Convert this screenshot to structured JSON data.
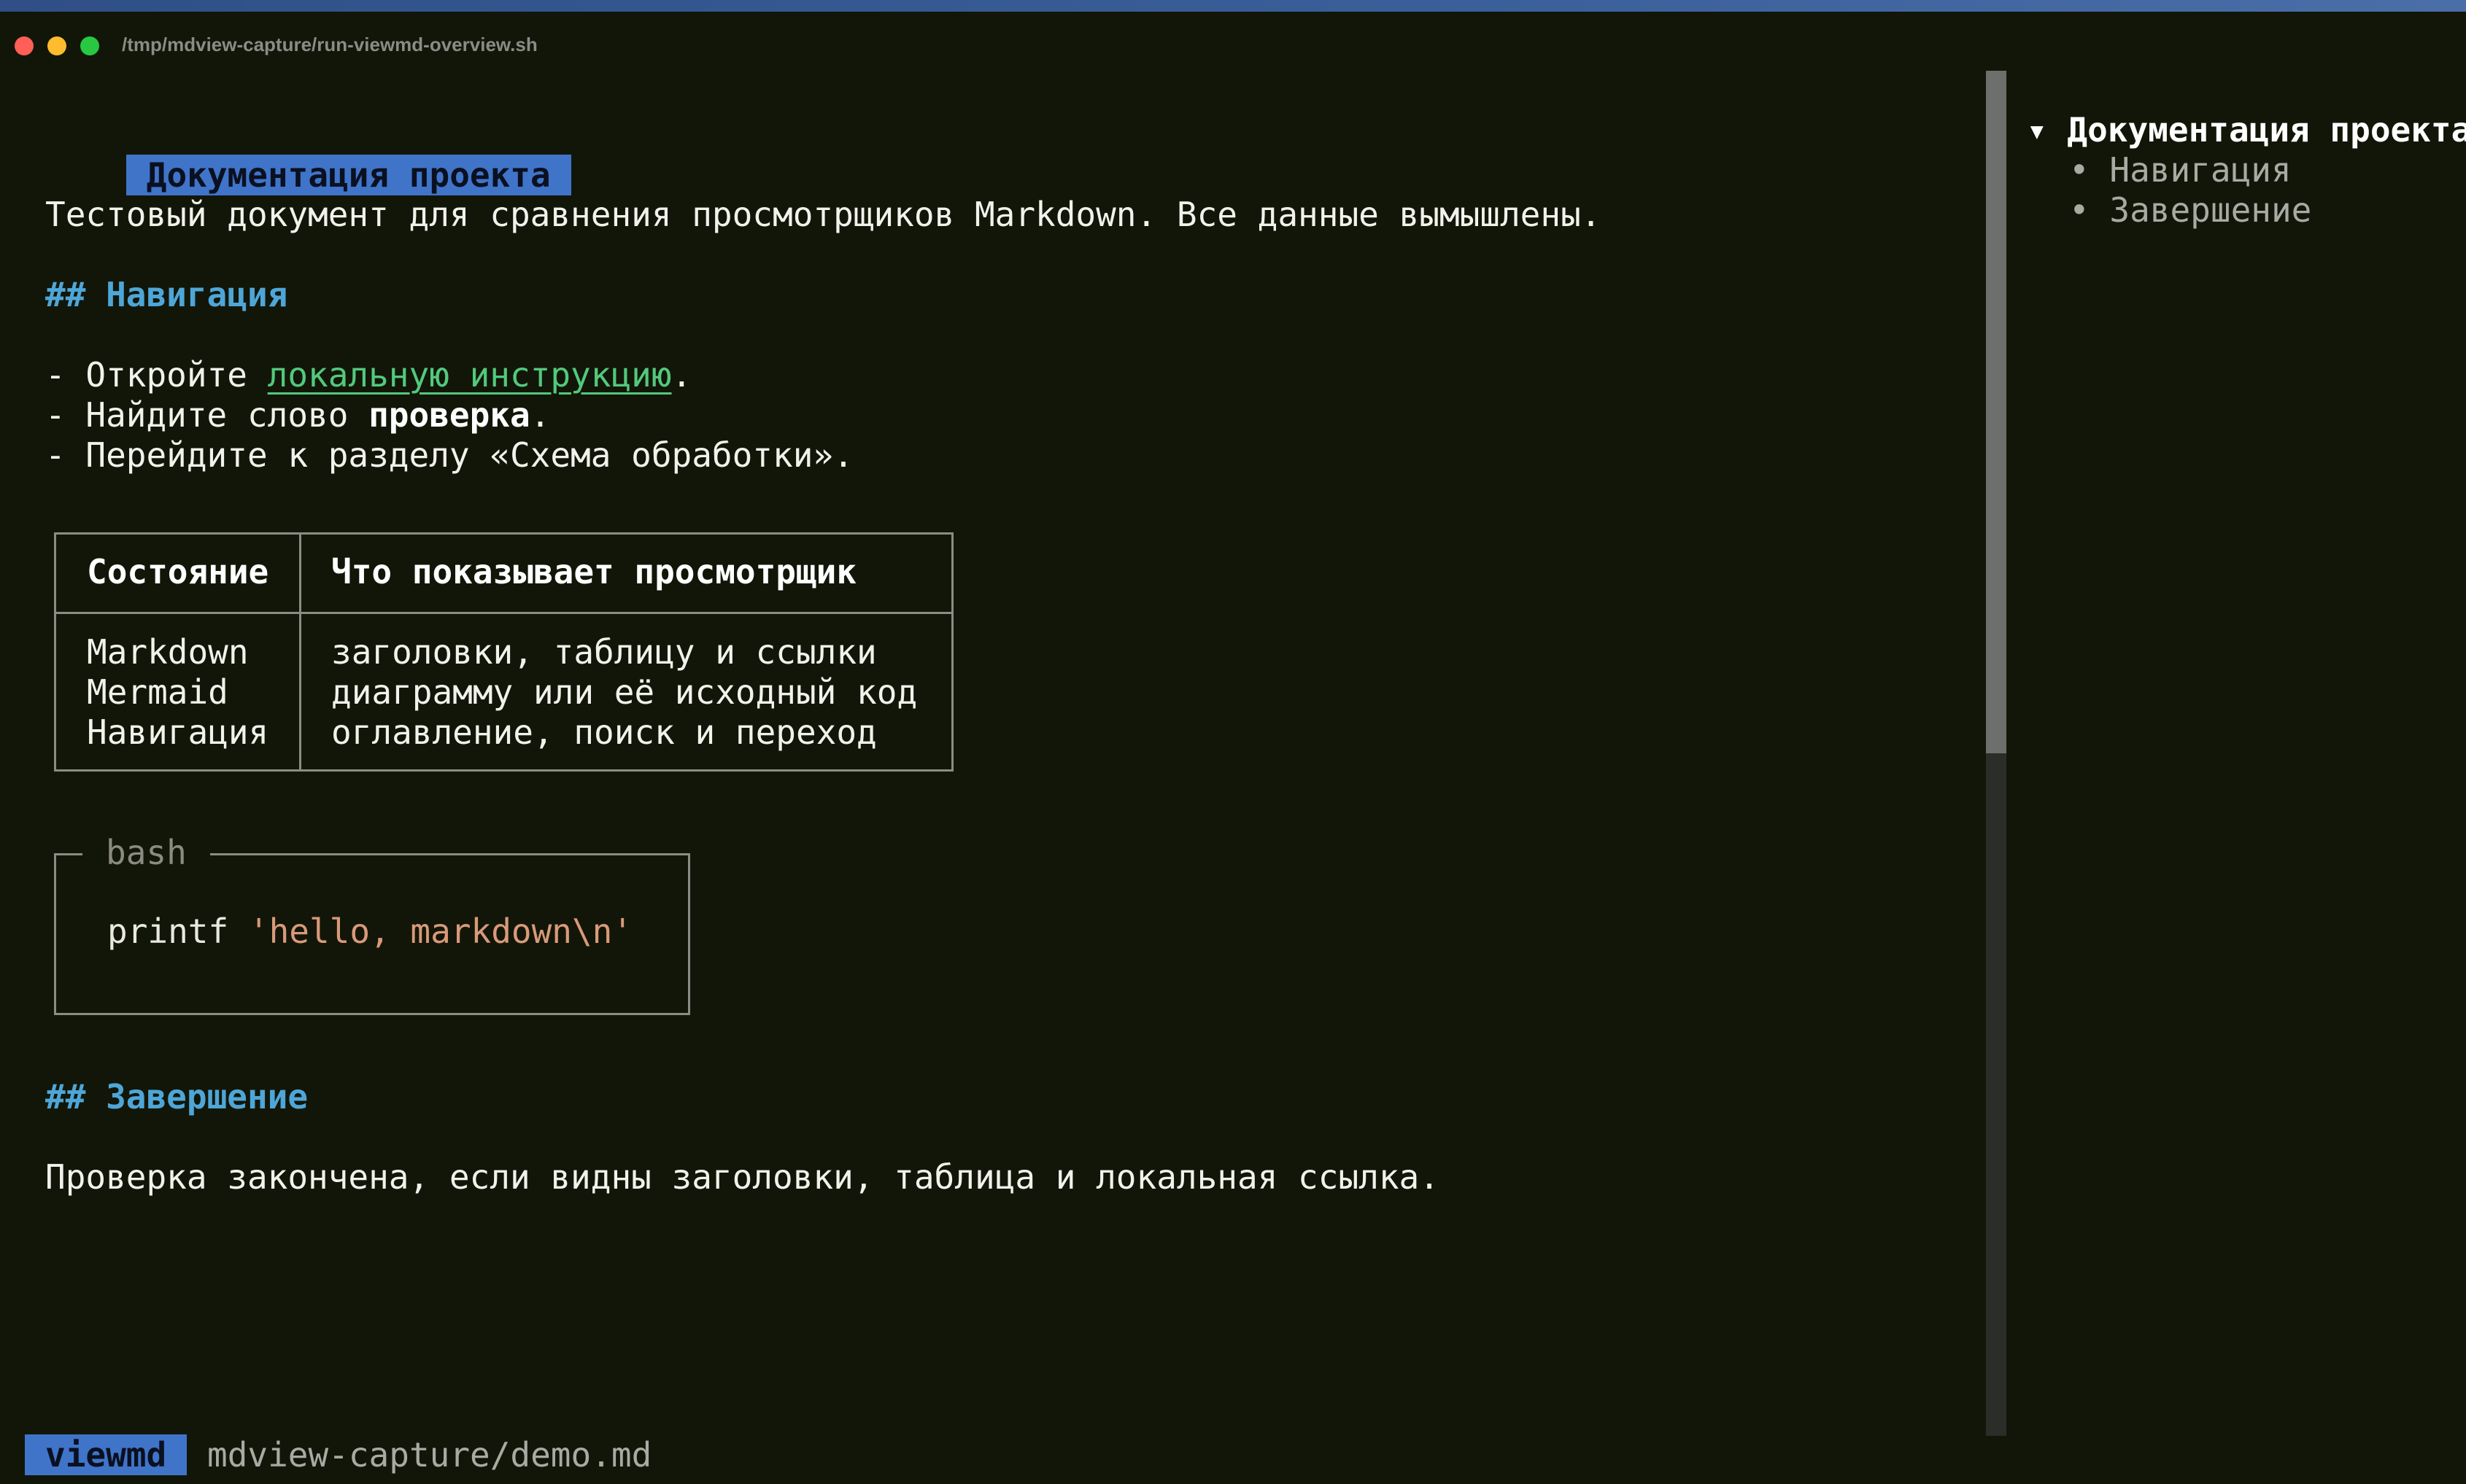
{
  "window": {
    "title": "/tmp/mdview-capture/run-viewmd-overview.sh"
  },
  "doc": {
    "h1": "Документация проекта",
    "intro": "Тестовый документ для сравнения просмотрщиков Markdown. Все данные вымышлены.",
    "section_nav": {
      "marker": "## ",
      "title": "Навигация"
    },
    "list": [
      {
        "prefix": "- Откройте ",
        "link": "локальную инструкцию",
        "suffix": "."
      },
      {
        "prefix": "- Найдите слово ",
        "bold": "проверка",
        "suffix": "."
      },
      {
        "text": "- Перейдите к разделу «Схема обработки»."
      }
    ],
    "table": {
      "headers": [
        "Состояние",
        "Что показывает просмотрщик"
      ],
      "rows": [
        [
          "Markdown",
          "заголовки, таблицу и ссылки"
        ],
        [
          "Mermaid",
          "диаграмму или её исходный код"
        ],
        [
          "Навигация",
          "оглавление, поиск и переход"
        ]
      ]
    },
    "code": {
      "lang": "bash",
      "command": "printf ",
      "string": "'hello, markdown\\n'"
    },
    "section_end": {
      "marker": "## ",
      "title": "Завершение"
    },
    "outro": "Проверка закончена, если видны заголовки, таблица и локальная ссылка."
  },
  "toc": {
    "arrow": "▾",
    "top": "Документация проекта",
    "bullet": "•",
    "items": [
      "Навигация",
      "Завершение"
    ]
  },
  "status": {
    "app": "viewmd",
    "path": "mdview-capture/demo.md"
  },
  "colors": {
    "background": "#121608",
    "accent": "#3f74c9",
    "heading": "#4ea6d8",
    "link": "#52c97c",
    "string": "#d99a7a"
  }
}
